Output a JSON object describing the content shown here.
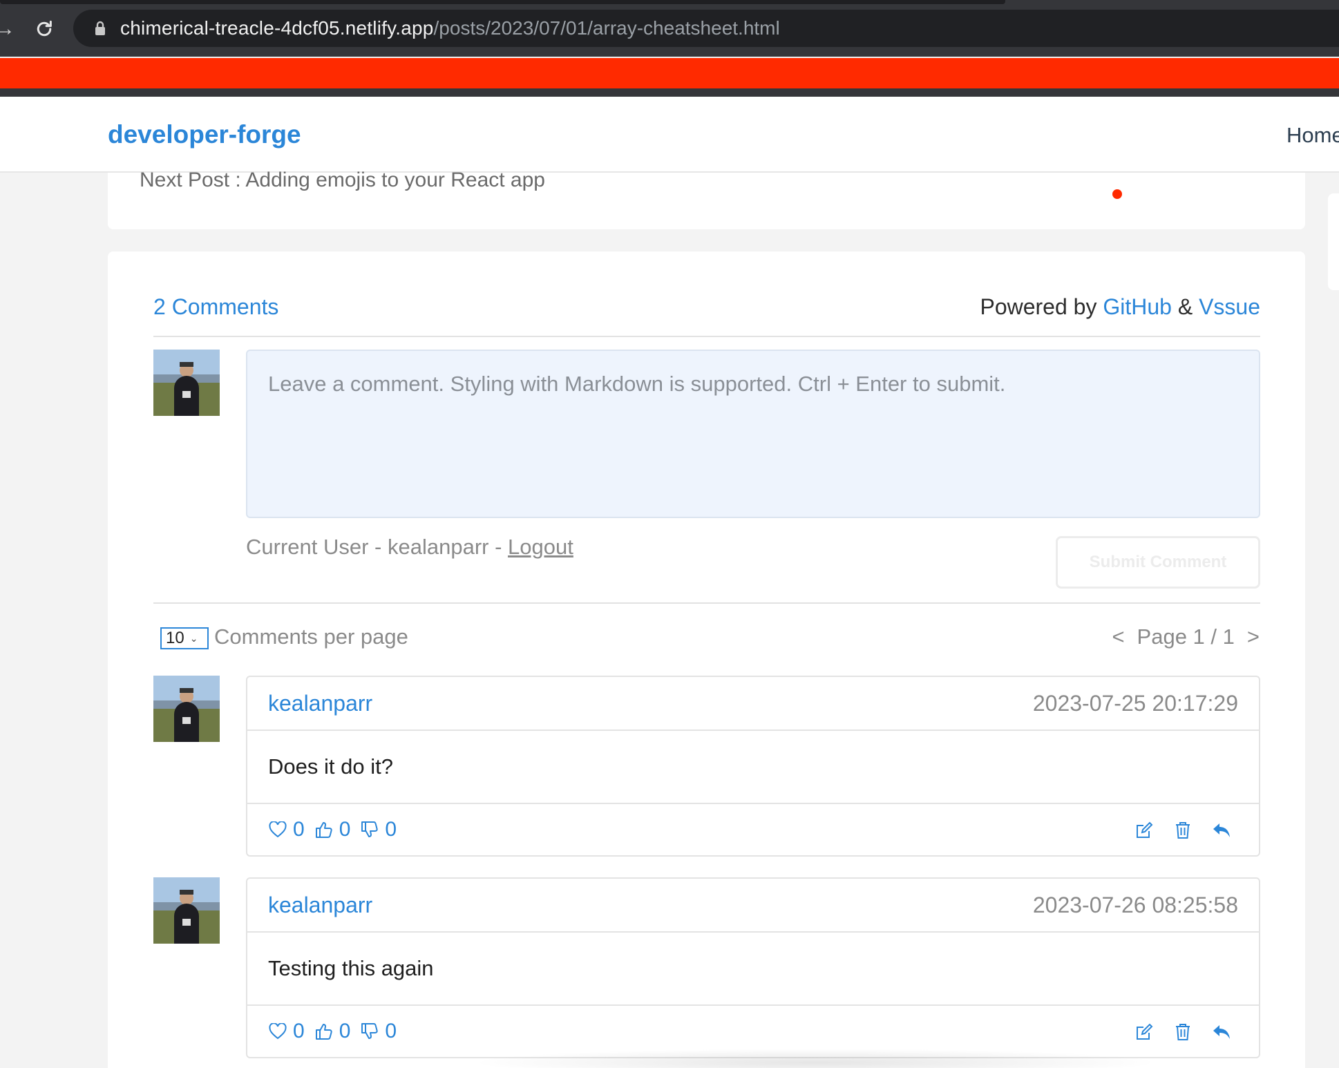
{
  "browser": {
    "url_domain": "chimerical-treacle-4dcf05.netlify.app",
    "url_path": "/posts/2023/07/01/array-cheatsheet.html"
  },
  "site": {
    "title": "developer-forge",
    "nav_home": "Home"
  },
  "post": {
    "next_post": "Next Post : Adding emojis to your React app"
  },
  "comments": {
    "count_label": "2 Comments",
    "powered_prefix": "Powered by",
    "powered_github": "GitHub",
    "powered_amp": "&",
    "powered_vssue": "Vssue",
    "input_placeholder": "Leave a comment. Styling with Markdown is supported. Ctrl + Enter to submit.",
    "current_user_prefix": "Current User - kealanparr -",
    "logout_label": "Logout",
    "submit_label": "Submit Comment",
    "per_page_value": "10",
    "per_page_label": "Comments per page",
    "pager_prev": "<",
    "pager_label": "Page 1 / 1",
    "pager_next": ">",
    "items": [
      {
        "author": "kealanparr",
        "time": "2023-07-25 20:17:29",
        "text": "Does it do it?",
        "hearts": "0",
        "likes": "0",
        "dislikes": "0"
      },
      {
        "author": "kealanparr",
        "time": "2023-07-26 08:25:58",
        "text": "Testing this again",
        "hearts": "0",
        "likes": "0",
        "dislikes": "0"
      }
    ]
  },
  "colors": {
    "accent": "#2b86d8",
    "red_bar": "#ff2a00",
    "chrome": "#35363a"
  }
}
